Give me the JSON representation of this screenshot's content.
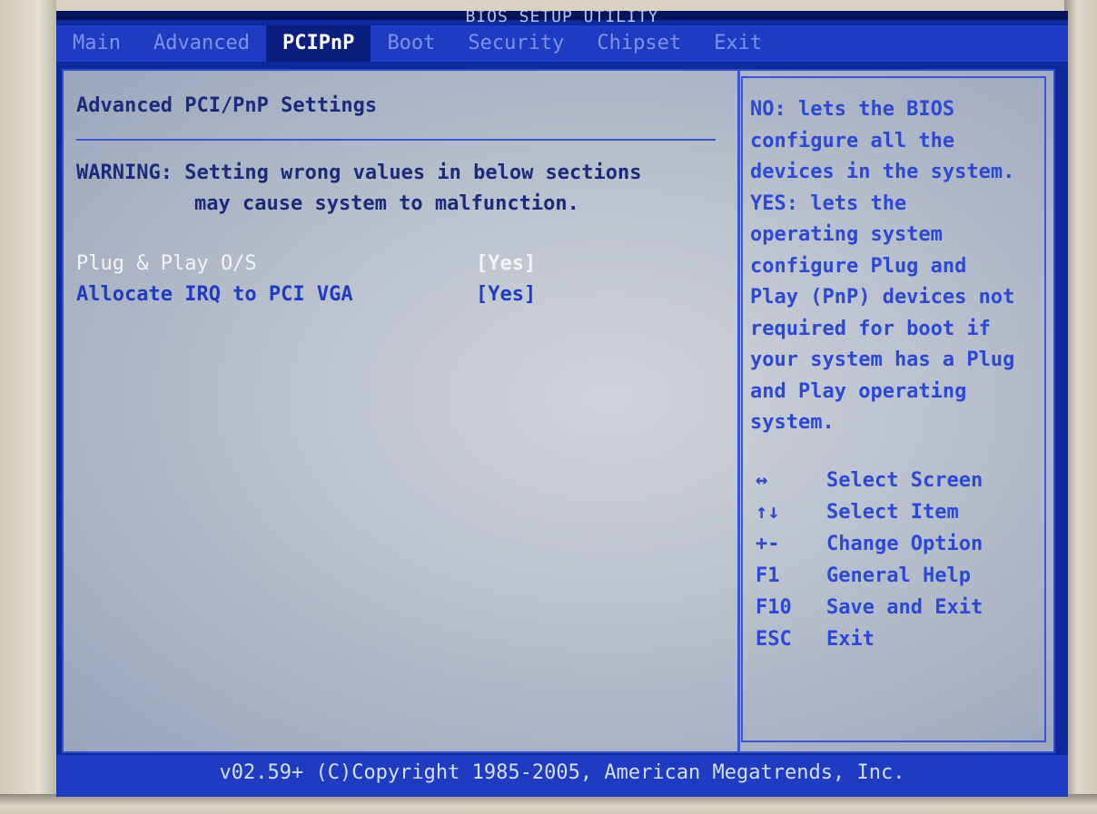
{
  "window": {
    "title": "BIOS SETUP UTILITY"
  },
  "tabs": [
    {
      "label": "Main"
    },
    {
      "label": "Advanced"
    },
    {
      "label": "PCIPnP"
    },
    {
      "label": "Boot"
    },
    {
      "label": "Security"
    },
    {
      "label": "Chipset"
    },
    {
      "label": "Exit"
    }
  ],
  "active_tab": "PCIPnP",
  "main": {
    "heading": "Advanced PCI/PnP Settings",
    "warning_line1": "WARNING: Setting wrong values in below sections",
    "warning_line2": "may cause system to malfunction.",
    "options": [
      {
        "label": "Plug & Play O/S",
        "value": "[Yes]",
        "selected": true
      },
      {
        "label": "Allocate IRQ to PCI VGA",
        "value": "[Yes]",
        "selected": false
      }
    ]
  },
  "help": {
    "lines": [
      "NO: lets the BIOS",
      "configure all the",
      "devices in the system.",
      "YES: lets the",
      "operating system",
      "configure Plug and",
      "Play (PnP) devices not",
      "required for boot if",
      "your system has a Plug",
      "and Play operating",
      "system."
    ],
    "keys": [
      {
        "key": "↔",
        "desc": "Select Screen"
      },
      {
        "key": "↑↓",
        "desc": "Select Item"
      },
      {
        "key": "+-",
        "desc": "Change Option"
      },
      {
        "key": "F1",
        "desc": "General Help"
      },
      {
        "key": "F10",
        "desc": "Save and Exit"
      },
      {
        "key": "ESC",
        "desc": "Exit"
      }
    ]
  },
  "footer": {
    "text": "v02.59+ (C)Copyright 1985-2005, American Megatrends, Inc."
  },
  "colors": {
    "screen_bg": "#0d2a9c",
    "tabbar": "#1d3cc2",
    "panel": "#c2c7d2",
    "accent_text": "#2c48d6"
  }
}
